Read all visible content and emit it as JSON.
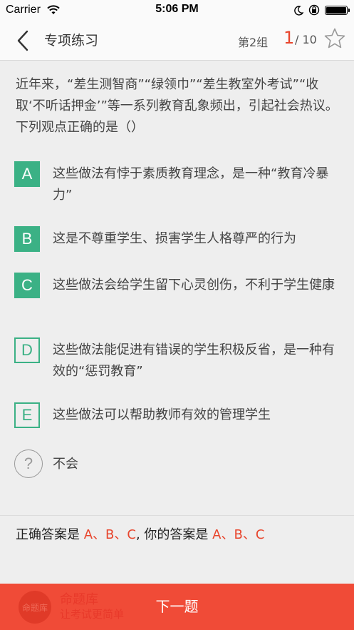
{
  "status_bar": {
    "carrier": "Carrier",
    "time": "5:06 PM"
  },
  "nav": {
    "title": "专项练习",
    "group": "第2组",
    "current": "1",
    "total": "/ 10"
  },
  "question": {
    "text": "近年来，“差生测智商”“绿领巾”“差生教室外考试”“收取‘不听话押金’”等一系列教育乱象频出，引起社会热议。下列观点正确的是（）"
  },
  "options": [
    {
      "letter": "A",
      "text": "这些做法有悖于素质教育理念，是一种“教育冷暴力”",
      "selected": true
    },
    {
      "letter": "B",
      "text": "这是不尊重学生、损害学生人格尊严的行为",
      "selected": true
    },
    {
      "letter": "C",
      "text": "这些做法会给学生留下心灵创伤，不利于学生健康",
      "selected": true
    },
    {
      "letter": "D",
      "text": "这些做法能促进有错误的学生积极反省，是一种有效的“惩罚教育”",
      "selected": false
    },
    {
      "letter": "E",
      "text": "这些做法可以帮助教师有效的管理学生",
      "selected": false
    }
  ],
  "dont_know": {
    "symbol": "?",
    "text": "不会"
  },
  "answer": {
    "correct_label": "正确答案是",
    "correct_value": "A、B、C",
    "separator": ", ",
    "yours_label": "你的答案是",
    "yours_value": "A、B、C"
  },
  "footer": {
    "logo_text": "命题库",
    "brand": "命题库",
    "slogan": "让考试更简单",
    "next_label": "下一题"
  },
  "colors": {
    "accent_green": "#3bb185",
    "accent_red": "#e8452c",
    "footer_bg": "#f04b37"
  }
}
